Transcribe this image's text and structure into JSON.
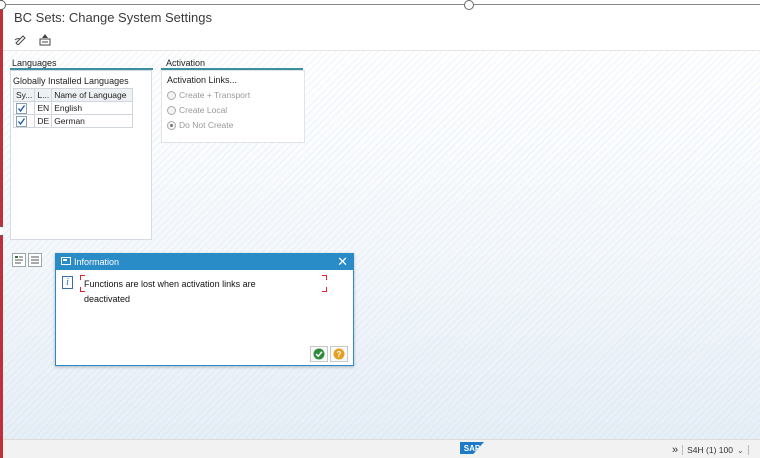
{
  "window": {
    "title": "BC Sets: Change System Settings"
  },
  "toolbar": {
    "items": [
      "edit-icon",
      "transport-icon"
    ]
  },
  "languages": {
    "group_title": "Languages",
    "table_title": "Globally Installed Languages",
    "columns": [
      "Sy...",
      "L...",
      "Name of Language"
    ],
    "rows": [
      {
        "checked": true,
        "code": "EN",
        "name": "English"
      },
      {
        "checked": true,
        "code": "DE",
        "name": "German"
      }
    ]
  },
  "activation": {
    "group_title": "Activation",
    "label": "Activation Links...",
    "options": [
      {
        "label": "Create + Transport",
        "selected": false
      },
      {
        "label": "Create Local",
        "selected": false
      },
      {
        "label": "Do Not Create",
        "selected": true
      }
    ]
  },
  "dialog": {
    "title": "Information",
    "close_label": "✕",
    "icon": "info-icon",
    "message_line1": "Functions are lost when activation links are",
    "message_line2": "deactivated",
    "buttons": [
      "confirm-icon",
      "help-icon"
    ]
  },
  "statusbar": {
    "logo": "SAP",
    "system": "S4H (1) 100",
    "expand_icon": "double-chevron-right-icon"
  },
  "colors": {
    "accent": "#2a8cc7",
    "frame": "#c0303a",
    "group_line": "#3a8fa0",
    "ok_green": "#2e8b3d",
    "help_orange": "#e6a020"
  }
}
